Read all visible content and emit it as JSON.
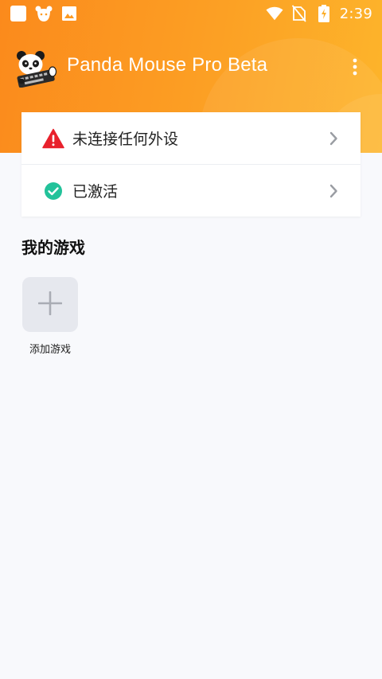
{
  "statusbar": {
    "time": "2:39",
    "left_icons": [
      "square-icon",
      "bear-icon",
      "image-icon"
    ],
    "right_icons": [
      "wifi-icon",
      "no-sim-icon",
      "battery-charging-icon"
    ]
  },
  "appbar": {
    "title": "Panda Mouse Pro Beta",
    "menu_icon": "more-vert-icon"
  },
  "status_card": {
    "rows": [
      {
        "label": "未连接任何外设",
        "icon": "warning-icon",
        "icon_color": "#e8212c"
      },
      {
        "label": "已激活",
        "icon": "check-circle-icon",
        "icon_color": "#22c29a"
      }
    ]
  },
  "games": {
    "section_title": "我的游戏",
    "add_label": "添加游戏"
  },
  "colors": {
    "header_start": "#fb8a1c",
    "header_end": "#fdb52b",
    "background": "#f8f9fc"
  }
}
